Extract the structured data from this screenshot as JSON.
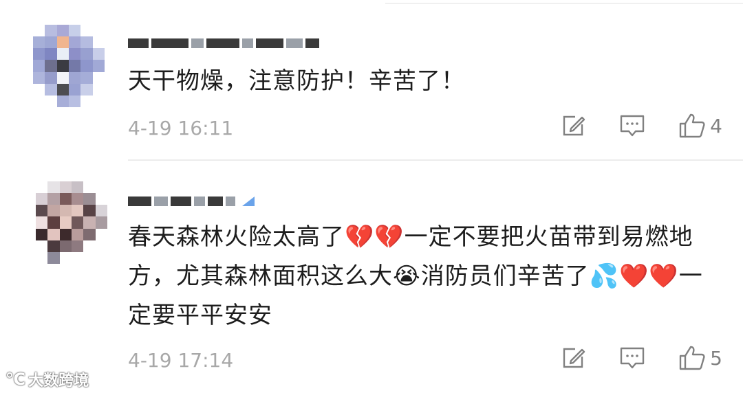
{
  "comments": [
    {
      "text": "天干物燥，注意防护！辛苦了！",
      "time": "4-19 16:11",
      "likes": "4"
    },
    {
      "text": "春天森林火险太高了💔💔一定不要把火苗带到易燃地方，尤其森林面积这么大😭消防员们辛苦了💦❤️❤️一定要平平安安",
      "time": "4-19 17:14",
      "likes": "5"
    }
  ],
  "icons": {
    "edit": "edit-icon",
    "reply": "comment-icon",
    "like": "thumbs-up-icon"
  },
  "watermark": {
    "logo": "℃",
    "text": "大数跨境"
  },
  "colors": {
    "text": "#1d1d1d",
    "meta": "#a8a8a8",
    "icon": "#808080",
    "verified_badge": "#6aa3ea"
  }
}
